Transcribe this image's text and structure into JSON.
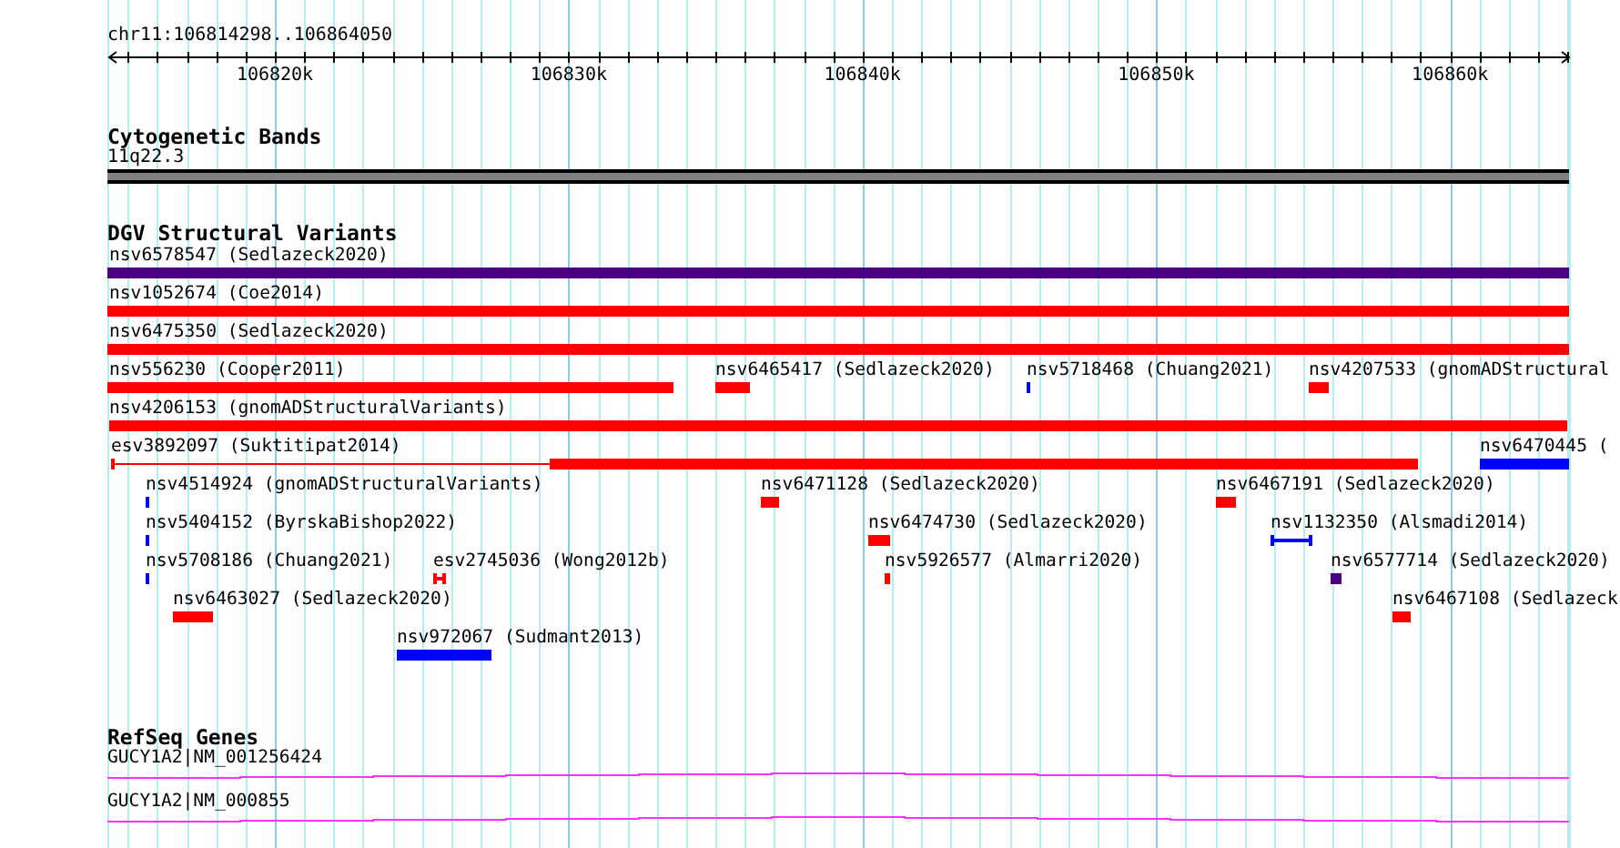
{
  "view": {
    "location": "chr11:106814298..106864050"
  },
  "ruler": {
    "ticks": [
      {
        "label": "106820k"
      },
      {
        "label": "106830k"
      },
      {
        "label": "106840k"
      },
      {
        "label": "106850k"
      },
      {
        "label": "106860k"
      }
    ]
  },
  "cytogenetic_bands": {
    "title": "Cytogenetic Bands",
    "band": {
      "label": "11q22.3"
    }
  },
  "dgv_track": {
    "title": "DGV Structural Variants",
    "rows": [
      {
        "features": [
          {
            "label": "nsv6578547 (Sedlazeck2020)",
            "kind": "block",
            "color": "#4b0082"
          }
        ]
      },
      {
        "features": [
          {
            "label": "nsv1052674 (Coe2014)",
            "kind": "block",
            "color": "#ff0000"
          }
        ]
      },
      {
        "features": [
          {
            "label": "nsv6475350 (Sedlazeck2020)",
            "kind": "block",
            "color": "#ff0000"
          }
        ]
      },
      {
        "features": [
          {
            "label": "nsv556230 (Cooper2011)",
            "kind": "block",
            "color": "#ff0000"
          },
          {
            "label": "nsv6465417 (Sedlazeck2020)",
            "kind": "block",
            "color": "#ff0000"
          },
          {
            "label": "nsv5718468 (Chuang2021)",
            "kind": "block",
            "color": "#0000ff"
          },
          {
            "label": "nsv4207533 (gnomADStructural",
            "kind": "block",
            "color": "#ff0000"
          }
        ]
      },
      {
        "features": [
          {
            "label": "nsv4206153 (gnomADStructuralVariants)",
            "kind": "block",
            "color": "#ff0000"
          }
        ]
      },
      {
        "features": [
          {
            "label": "esv3892097 (Suktitipat2014)",
            "kind": "gapped",
            "color": "#ff0000"
          },
          {
            "label": "nsv6470445 (",
            "kind": "block",
            "color": "#0000ff"
          }
        ]
      },
      {
        "features": [
          {
            "label": "nsv4514924 (gnomADStructuralVariants)",
            "kind": "block",
            "color": "#0000ff"
          },
          {
            "label": "nsv6471128 (Sedlazeck2020)",
            "kind": "block",
            "color": "#ff0000"
          },
          {
            "label": "nsv6467191 (Sedlazeck2020)",
            "kind": "block",
            "color": "#ff0000"
          }
        ]
      },
      {
        "features": [
          {
            "label": "nsv5404152 (ByrskaBishop2022)",
            "kind": "block",
            "color": "#0000ff"
          },
          {
            "label": "nsv6474730 (Sedlazeck2020)",
            "kind": "block",
            "color": "#ff0000"
          },
          {
            "label": "nsv1132350 (Alsmadi2014)",
            "kind": "capped",
            "color": "#0000ff"
          }
        ]
      },
      {
        "features": [
          {
            "label": "nsv5708186 (Chuang2021)",
            "kind": "block",
            "color": "#0000ff"
          },
          {
            "label": "esv2745036 (Wong2012b)",
            "kind": "capped",
            "color": "#ff0000"
          },
          {
            "label": "nsv5926577 (Almarri2020)",
            "kind": "block",
            "color": "#ff0000"
          },
          {
            "label": "nsv6577714 (Sedlazeck2020)",
            "kind": "block",
            "color": "#4b0082"
          }
        ]
      },
      {
        "features": [
          {
            "label": "nsv6463027 (Sedlazeck2020)",
            "kind": "block",
            "color": "#ff0000"
          },
          {
            "label": "nsv6467108 (Sedlazeck",
            "kind": "block",
            "color": "#ff0000"
          }
        ]
      },
      {
        "features": [
          {
            "label": "nsv972067 (Sudmant2013)",
            "kind": "block",
            "color": "#0000ff"
          }
        ]
      }
    ]
  },
  "refseq_track": {
    "title": "RefSeq Genes",
    "genes": [
      {
        "label": "GUCY1A2|NM_001256424"
      },
      {
        "label": "GUCY1A2|NM_000855"
      }
    ]
  }
}
